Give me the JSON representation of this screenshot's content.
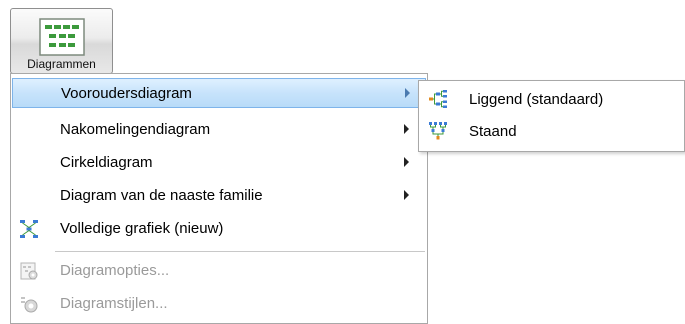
{
  "ribbon": {
    "button_label": "Diagrammen",
    "button_icon": "diagrams-icon"
  },
  "menu": {
    "items": [
      {
        "label": "Vooroudersdiagram",
        "has_submenu": true,
        "state": "highlighted",
        "icon": ""
      },
      {
        "label": "Nakomelingendiagram",
        "has_submenu": true,
        "state": "normal",
        "icon": ""
      },
      {
        "label": "Cirkeldiagram",
        "has_submenu": true,
        "state": "normal",
        "icon": ""
      },
      {
        "label": "Diagram van de naaste familie",
        "has_submenu": true,
        "state": "normal",
        "icon": ""
      },
      {
        "label": "Volledige grafiek (nieuw)",
        "has_submenu": false,
        "state": "normal",
        "icon": "full-graph-icon"
      },
      {
        "label": "Diagramopties...",
        "has_submenu": false,
        "state": "disabled",
        "icon": "chart-options-icon"
      },
      {
        "label": "Diagramstijlen...",
        "has_submenu": false,
        "state": "disabled",
        "icon": "chart-styles-icon"
      }
    ]
  },
  "submenu": {
    "items": [
      {
        "label": "Liggend (standaard)",
        "icon": "horizontal-tree-icon"
      },
      {
        "label": "Staand",
        "icon": "vertical-tree-icon"
      }
    ]
  },
  "colors": {
    "highlight_border": "#7eb4ea",
    "highlight_fill": "#c7e3fb",
    "disabled_text": "#9a9a9a",
    "icon_green": "#3c9a3c",
    "icon_blue": "#3a7bd5",
    "icon_orange": "#e08a1e"
  }
}
